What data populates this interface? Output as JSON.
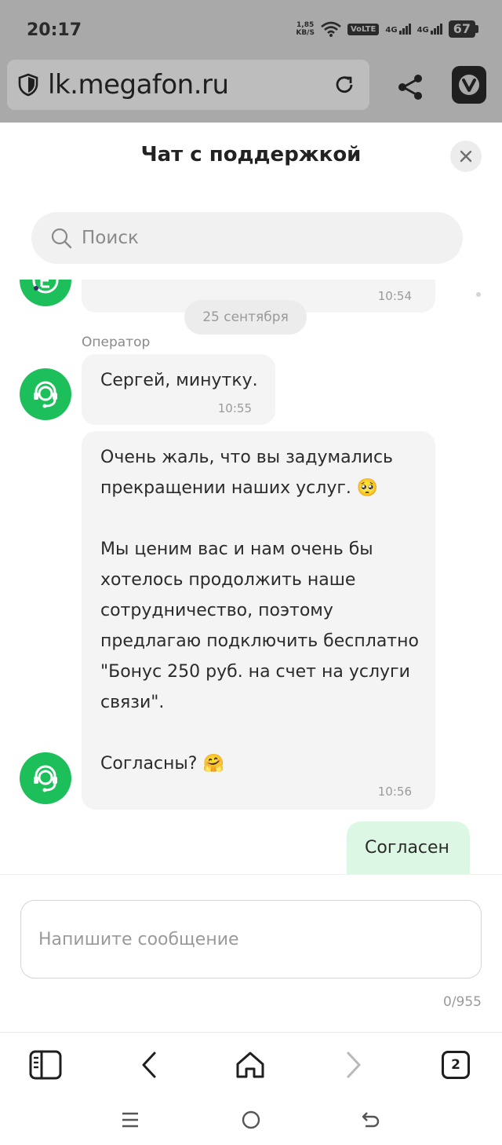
{
  "status_bar": {
    "time": "20:17",
    "net_speed_value": "1,85",
    "net_speed_unit": "KB/S",
    "volte": "VoLTE",
    "sim1": "4G",
    "sim2": "4G",
    "battery": "67"
  },
  "browser": {
    "url": "lk.megafon.ru",
    "tabs_count": "2"
  },
  "chat": {
    "title": "Чат с поддержкой",
    "search_placeholder": "Поиск",
    "messages": [
      {
        "time": "10:54"
      },
      {
        "date_separator": "25 сентября"
      },
      {
        "sender": "Оператор",
        "text": "Сергей, минутку.",
        "time": "10:55"
      },
      {
        "lines": [
          "Очень жаль, что вы задумались",
          "прекращении наших услуг. 🥺",
          "",
          "Мы ценим вас и нам очень бы",
          "хотелось продолжить наше",
          "сотрудничество, поэтому",
          "предлагаю подключить бесплатно",
          "\"Бонус 250 руб. на счет на услуги",
          "связи\".",
          "",
          "Согласны? 🤗"
        ],
        "time": "10:56"
      },
      {
        "from": "user",
        "text": "Согласен"
      }
    ],
    "composer_placeholder": "Напишите сообщение",
    "char_counter": "0/955"
  },
  "colors": {
    "brand_green": "#1dbf5b",
    "user_bubble": "#dcf8e4",
    "operator_bubble": "#f4f4f4"
  }
}
